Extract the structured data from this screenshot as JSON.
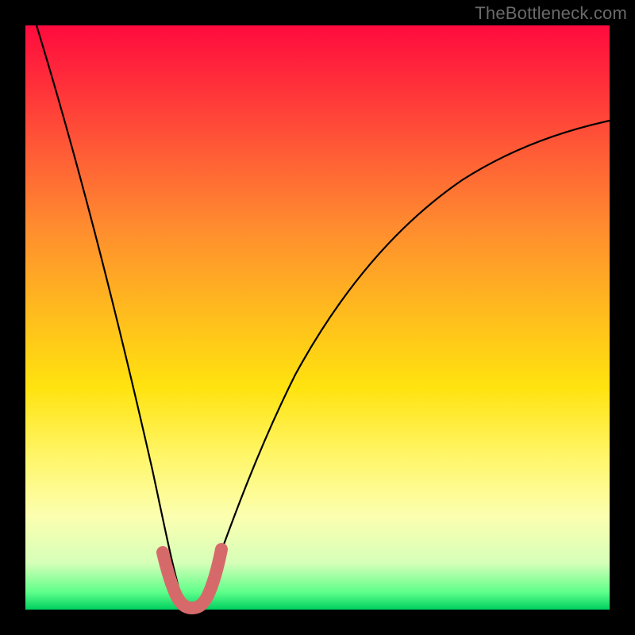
{
  "watermark": "TheBottleneck.com",
  "chart_data": {
    "type": "line",
    "title": "",
    "xlabel": "",
    "ylabel": "",
    "xlim": [
      0,
      1
    ],
    "ylim": [
      0,
      1
    ],
    "series": [
      {
        "name": "main-curve",
        "x": [
          0.02,
          0.05,
          0.08,
          0.11,
          0.14,
          0.17,
          0.2,
          0.23,
          0.25,
          0.27,
          0.29,
          0.31,
          0.34,
          0.38,
          0.42,
          0.47,
          0.52,
          0.58,
          0.64,
          0.7,
          0.76,
          0.82,
          0.88,
          0.94,
          1.0
        ],
        "y": [
          1.0,
          0.88,
          0.76,
          0.64,
          0.52,
          0.4,
          0.28,
          0.16,
          0.06,
          0.02,
          0.02,
          0.06,
          0.16,
          0.3,
          0.42,
          0.52,
          0.6,
          0.66,
          0.71,
          0.75,
          0.78,
          0.8,
          0.82,
          0.83,
          0.84
        ]
      },
      {
        "name": "valley-highlight",
        "x": [
          0.23,
          0.238,
          0.245,
          0.253,
          0.26,
          0.267,
          0.275,
          0.283,
          0.29,
          0.298,
          0.305,
          0.313,
          0.32
        ],
        "y": [
          0.09,
          0.065,
          0.042,
          0.025,
          0.015,
          0.012,
          0.012,
          0.015,
          0.025,
          0.042,
          0.065,
          0.09,
          0.12
        ]
      }
    ],
    "colors": {
      "curve": "#000000",
      "highlight": "#d66a6a"
    }
  }
}
